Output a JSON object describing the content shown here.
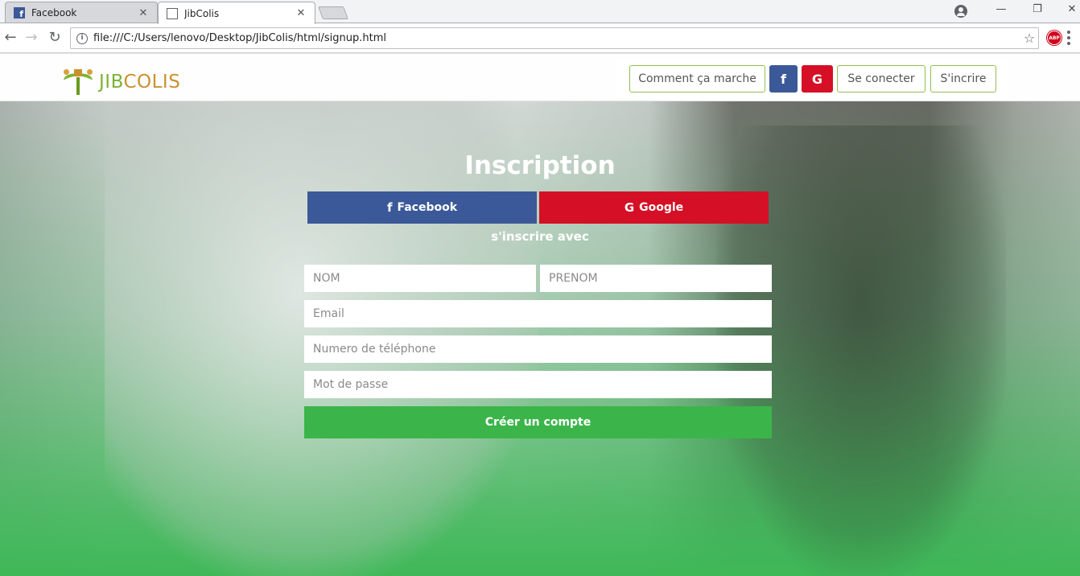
{
  "browser": {
    "tabs": [
      {
        "title": "Facebook",
        "favicon": "facebook-favicon",
        "close": "✕"
      },
      {
        "title": "JibColis",
        "favicon": "document-icon",
        "close": "✕"
      }
    ],
    "url": "file:///C:/Users/lenovo/Desktop/JibColis/html/signup.html",
    "abp_label": "ABP"
  },
  "site": {
    "logo": {
      "part1": "JIB",
      "part2": "COLIS"
    },
    "nav": {
      "how_it_works": "Comment ça marche",
      "facebook_glyph": "f",
      "google_glyph": "G",
      "login": "Se conecter",
      "signup": "S'incrire"
    }
  },
  "signup": {
    "title": "Inscription",
    "facebook_label": "Facebook",
    "google_label": "Google",
    "subtitle": "s'inscrire avec",
    "fields": {
      "nom_placeholder": "NOM",
      "prenom_placeholder": "PRENOM",
      "email_placeholder": "Email",
      "phone_placeholder": "Numero de téléphone",
      "password_placeholder": "Mot de passe"
    },
    "submit_label": "Créer un compte"
  },
  "colors": {
    "facebook": "#3b5998",
    "google": "#d50f25",
    "primary_green": "#3bb54a",
    "nav_border": "#8fbf4f",
    "logo_green": "#7cb334",
    "logo_gold": "#c9922f"
  }
}
